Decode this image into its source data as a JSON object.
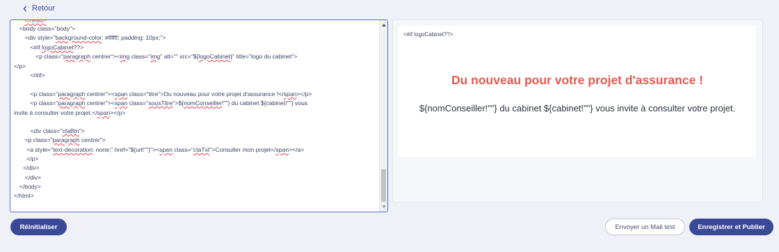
{
  "nav": {
    "back_label": "Retour"
  },
  "editor": {
    "lines": [
      {
        "indent": 3,
        "text": "<body class=\"body\">"
      },
      {
        "indent": 6,
        "text": "<div style=\"background-color: #ffffff; padding: 10px;\">"
      },
      {
        "indent": 9,
        "text": "<#if logoCabinet??>"
      },
      {
        "indent": 12,
        "text": "<p class=\"paragraph centrer\"><img class=\"img\" alt=\"\" src=\"${logoCabinet}\" title=\"logo du cabinet\">"
      },
      {
        "indent": 0,
        "text": "</p>"
      },
      {
        "indent": 9,
        "text": "</#if>"
      },
      {
        "indent": 9,
        "text": "<p class=\"paragraph centrer\"><span class=\"titre\">Du nouveau pour votre projet d'assurance !</span></p>"
      },
      {
        "indent": 9,
        "text": "<p class=\"paragraph centrer\"><span class=\"sousTitre\">${nomConseiller!\"\"} du cabinet ${cabinet!\"\"} vous"
      },
      {
        "indent": 0,
        "text": "invite à consulter votre projet.</span></p>"
      },
      {
        "indent": 9,
        "text": "<div class=\"ctaBtn\">"
      },
      {
        "indent": 6,
        "text": "<p class=\"paragraph centrer\">"
      },
      {
        "indent": 7,
        "text": "<a style=\"text-decoration: none;\" href=\"${url!\"\"}\"><span class=\"ctaTxt\">Consulter mon projet</span></a>"
      },
      {
        "indent": 7,
        "text": "</p>"
      },
      {
        "indent": 5,
        "text": "</div>"
      },
      {
        "indent": 6,
        "text": "</div>"
      },
      {
        "indent": 3,
        "text": "</body>"
      },
      {
        "indent": 0,
        "text": "</html>"
      }
    ]
  },
  "preview": {
    "if_directive": "<#if logoCabinet??>",
    "title": "Du nouveau pour votre projet d'assurance !",
    "subtitle": "${nomConseiller!\"\"} du cabinet ${cabinet!\"\"} vous invite à consulter votre projet."
  },
  "actions": {
    "reset_label": "Réinitialiser",
    "test_mail_label": "Envoyer un Mail test",
    "save_publish_label": "Enregistrer et Publier"
  },
  "colors": {
    "primary": "#3a4996",
    "editor_border": "#4b6fd6",
    "title_red": "#e8574e"
  }
}
